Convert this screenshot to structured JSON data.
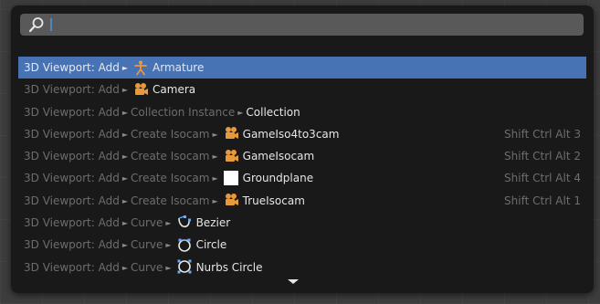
{
  "search": {
    "value": "",
    "icon": "search-icon"
  },
  "results": [
    {
      "path": [
        "3D Viewport: Add"
      ],
      "label": "Armature",
      "icon": "armature-icon",
      "shortcut": "",
      "active": true
    },
    {
      "path": [
        "3D Viewport: Add"
      ],
      "label": "Camera",
      "icon": "camera-icon",
      "shortcut": ""
    },
    {
      "path": [
        "3D Viewport: Add",
        "Collection Instance"
      ],
      "label": "Collection",
      "icon": "",
      "shortcut": ""
    },
    {
      "path": [
        "3D Viewport: Add",
        "Create Isocam"
      ],
      "label": "GameIso4to3cam",
      "icon": "camera-icon",
      "shortcut": "Shift Ctrl Alt 3"
    },
    {
      "path": [
        "3D Viewport: Add",
        "Create Isocam"
      ],
      "label": "GameIsocam",
      "icon": "camera-icon",
      "shortcut": "Shift Ctrl Alt 2"
    },
    {
      "path": [
        "3D Viewport: Add",
        "Create Isocam"
      ],
      "label": "Groundplane",
      "icon": "white-square-icon",
      "shortcut": "Shift Ctrl Alt 4"
    },
    {
      "path": [
        "3D Viewport: Add",
        "Create Isocam"
      ],
      "label": "TrueIsocam",
      "icon": "camera-icon",
      "shortcut": "Shift Ctrl Alt 1"
    },
    {
      "path": [
        "3D Viewport: Add",
        "Curve"
      ],
      "label": "Bezier",
      "icon": "bezier-curve-icon",
      "shortcut": ""
    },
    {
      "path": [
        "3D Viewport: Add",
        "Curve"
      ],
      "label": "Circle",
      "icon": "curve-circle-icon",
      "shortcut": ""
    },
    {
      "path": [
        "3D Viewport: Add",
        "Curve"
      ],
      "label": "Nurbs Circle",
      "icon": "nurbs-circle-icon",
      "shortcut": ""
    }
  ],
  "separator": "►",
  "colors": {
    "highlight": "#4772b3",
    "icon_orange": "#e8993c",
    "curve_blue": "#6fa8f5",
    "menu_bg": "#191919"
  }
}
